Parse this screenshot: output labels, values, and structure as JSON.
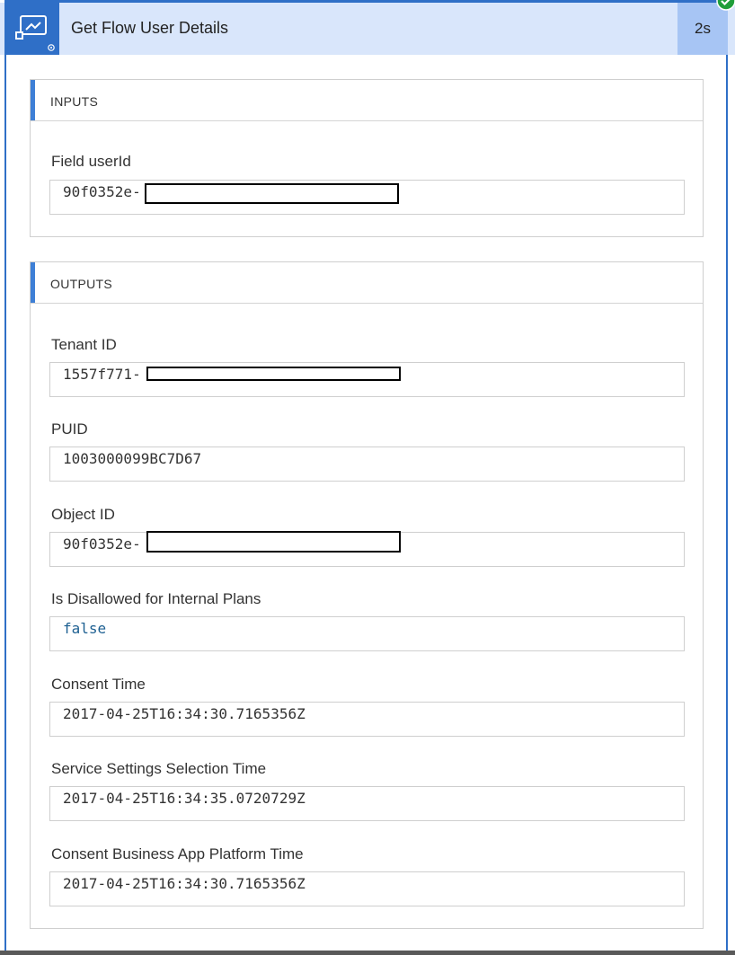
{
  "header": {
    "title": "Get Flow User Details",
    "duration": "2s",
    "action_icon": "flow-action-icon",
    "status_icon": "success-check-icon"
  },
  "colors": {
    "accent": "#2f6fc7",
    "header_bg": "#d9e6fb",
    "duration_bg": "#a7c5f4",
    "success": "#1f9e3a"
  },
  "inputs": {
    "title": "INPUTS",
    "fields": [
      {
        "label": "Field userId",
        "value": "90f0352e-"
      }
    ]
  },
  "outputs": {
    "title": "OUTPUTS",
    "fields": [
      {
        "label": "Tenant ID",
        "value": "1557f771-"
      },
      {
        "label": "PUID",
        "value": "1003000099BC7D67"
      },
      {
        "label": "Object ID",
        "value": "90f0352e-"
      },
      {
        "label": "Is Disallowed for Internal Plans",
        "value": "false"
      },
      {
        "label": "Consent Time",
        "value": "2017-04-25T16:34:30.7165356Z"
      },
      {
        "label": "Service Settings Selection Time",
        "value": "2017-04-25T16:34:35.0720729Z"
      },
      {
        "label": "Consent Business App Platform Time",
        "value": "2017-04-25T16:34:30.7165356Z"
      }
    ]
  }
}
